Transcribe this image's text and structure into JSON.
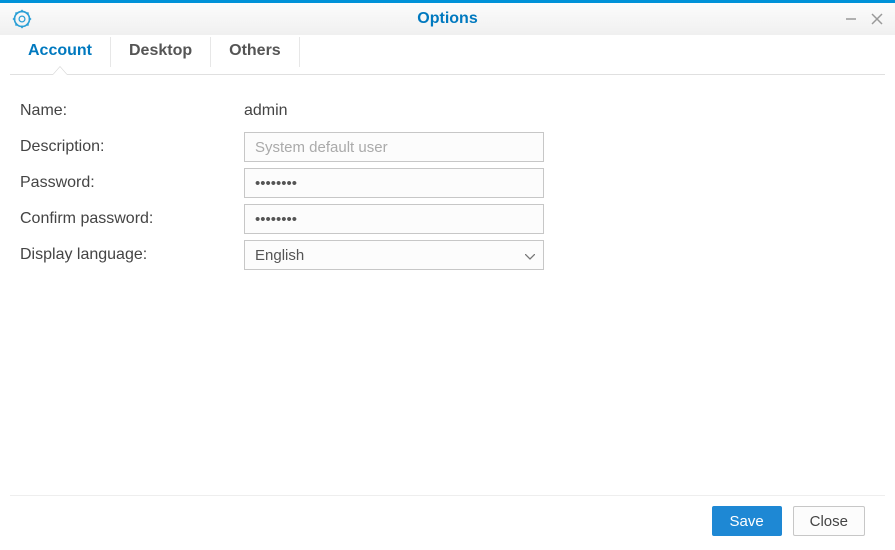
{
  "titlebar": {
    "title": "Options"
  },
  "tabs": [
    {
      "label": "Account",
      "active": true
    },
    {
      "label": "Desktop",
      "active": false
    },
    {
      "label": "Others",
      "active": false
    }
  ],
  "form": {
    "name_label": "Name:",
    "name_value": "admin",
    "description_label": "Description:",
    "description_placeholder": "System default user",
    "description_value": "",
    "password_label": "Password:",
    "password_value": "••••••••",
    "confirm_label": "Confirm password:",
    "confirm_value": "••••••••",
    "language_label": "Display language:",
    "language_value": "English"
  },
  "footer": {
    "save_label": "Save",
    "close_label": "Close"
  }
}
